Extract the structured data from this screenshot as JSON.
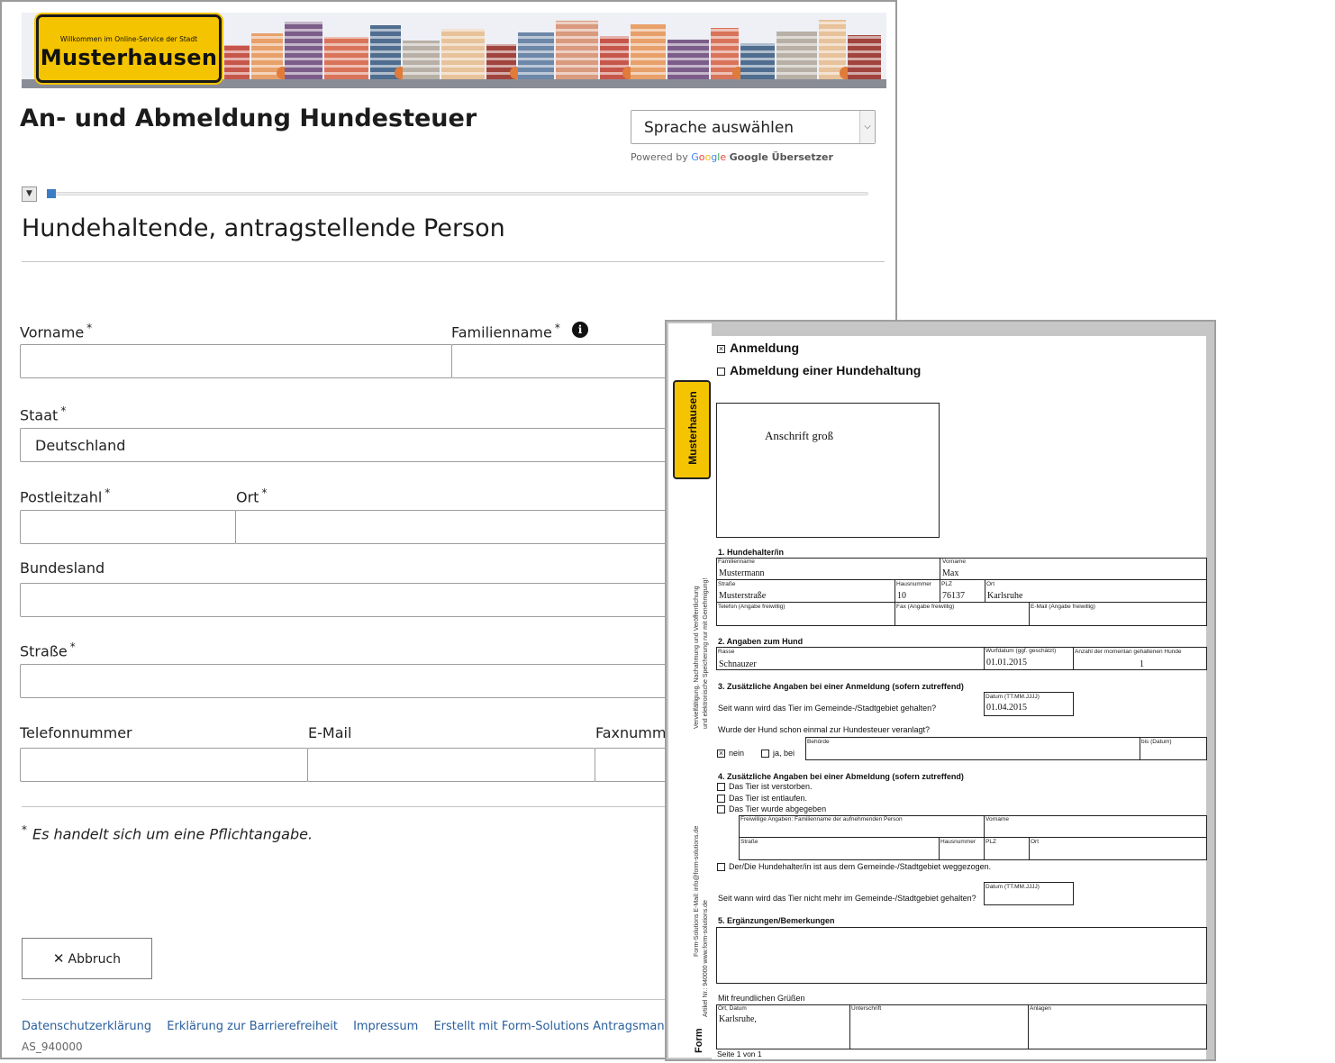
{
  "banner": {
    "sign_small": "Willkommen im Online-Service der Stadt",
    "sign_big": "Musterhausen"
  },
  "header": {
    "title": "An- und Abmeldung Hundesteuer",
    "language_select": "Sprache auswählen",
    "powered_by": "Powered by",
    "google_logo": [
      "G",
      "o",
      "o",
      "g",
      "l",
      "e"
    ],
    "translator": "Google Übersetzer"
  },
  "progress": {
    "value_percent": 1
  },
  "section": {
    "title": "Hundehaltende, antragstellende Person"
  },
  "form": {
    "vorname_label": "Vorname",
    "familienname_label": "Familienname",
    "staat_label": "Staat",
    "staat_value": "Deutschland",
    "plz_label": "Postleitzahl",
    "ort_label": "Ort",
    "bundesland_label": "Bundesland",
    "strasse_label": "Straße",
    "telefon_label": "Telefonnummer",
    "email_label": "E-Mail",
    "fax_label": "Faxnumme",
    "required_mark": "*",
    "info_icon_glyph": "i"
  },
  "required_note": "Es handelt sich um eine Pflichtangabe.",
  "cancel_button": {
    "icon": "✕",
    "label": "Abbruch"
  },
  "footer": {
    "links": [
      "Datenschutzerklärung",
      "Erklärung zur Barrierefreiheit",
      "Impressum",
      "Erstellt mit Form-Solutions Antragsmanagement"
    ],
    "code": "AS_940000"
  },
  "pdf": {
    "logo": "Musterhausen",
    "anmeldung": "Anmeldung",
    "abmeldung": "Abmeldung einer Hundehaltung",
    "check_mark": "×",
    "address_box": "Anschrift groß",
    "side_text_1": "Vervielfältigung, Nachahmung und Veröffentlichung",
    "side_text_2": "und elektronische Speicherung nur mit Genehmigung!",
    "side_text_3": "Form-Solutions  E-Mail:  info@form-solutions.de",
    "side_text_4": "Artikel Nr.:  940000    www.form-solutions.de",
    "form_logo": "Form",
    "s1": {
      "heading": "1. Hundehalter/in",
      "familienname_label": "Familienname",
      "familienname": "Mustermann",
      "vorname_label": "Vorname",
      "vorname": "Max",
      "strasse_label": "Straße",
      "strasse": "Musterstraße",
      "hausnummer_label": "Hausnummer",
      "hausnummer": "10",
      "plz_label": "PLZ",
      "plz": "76137",
      "ort_label": "Ort",
      "ort": "Karlsruhe",
      "telefon_label": "Telefon (Angabe freiwillig)",
      "fax_label": "Fax (Angabe freiwillig)",
      "email_label": "E-Mail (Angabe freiwillig)"
    },
    "s2": {
      "heading": "2. Angaben zum Hund",
      "rasse_label": "Rasse",
      "rasse": "Schnauzer",
      "wurf_label": "Wurfdatum (ggf. geschätzt)",
      "wurf": "01.01.2015",
      "anzahl_label": "Anzahl der momentan gehaltenen Hunde",
      "anzahl": "1"
    },
    "s3": {
      "heading": "3. Zusätzliche Angaben bei einer Anmeldung (sofern zutreffend)",
      "seit_wann": "Seit wann wird das Tier im Gemeinde-/Stadtgebiet gehalten?",
      "datum_label": "Datum (TT.MM.JJJJ)",
      "datum": "01.04.2015",
      "veranlagt": "Wurde der Hund schon einmal zur Hundesteuer veranlagt?",
      "nein": "nein",
      "ja_bei": "ja, bei",
      "behoerde_label": "Behörde",
      "bis_label": "bis (Datum)"
    },
    "s4": {
      "heading": "4. Zusätzliche Angaben bei einer Abmeldung (sofern zutreffend)",
      "verstorben": "Das Tier ist verstorben.",
      "entlaufen": "Das Tier ist entlaufen.",
      "abgegeben": "Das Tier wurde abgegeben",
      "aufn_name_label": "Freiwillige Angaben: Familienname der aufnehmenden Person",
      "aufn_vorname_label": "Vorname",
      "aufn_strasse_label": "Straße",
      "aufn_hausnr_label": "Hausnummer",
      "aufn_plz_label": "PLZ",
      "aufn_ort_label": "Ort",
      "weggezogen": "Der/Die Hundehalter/in ist aus dem Gemeinde-/Stadtgebiet weggezogen.",
      "seit_wann_nicht": "Seit wann wird das Tier nicht mehr im Gemeinde-/Stadtgebiet gehalten?",
      "datum_label": "Datum (TT.MM.JJJJ)"
    },
    "s5": {
      "heading": "5. Ergänzungen/Bemerkungen"
    },
    "gruss": "Mit freundlichen Grüßen",
    "ort_datum_label": "Ort, Datum",
    "ort_datum": "Karlsruhe,",
    "unterschrift_label": "Unterschrift",
    "anlagen_label": "Anlagen",
    "page_info": "Seite 1 von 1"
  }
}
